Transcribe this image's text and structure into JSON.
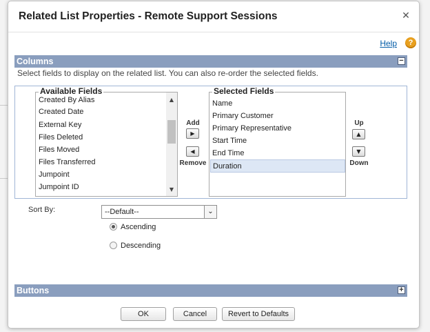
{
  "dialog": {
    "title": "Related List Properties - Remote Support Sessions",
    "close_icon": "close-icon",
    "help_label": "Help",
    "help_icon": "help-icon"
  },
  "columns_section": {
    "title": "Columns",
    "description": "Select fields to display on the related list. You can also re-order the selected fields.",
    "available_legend": "Available Fields",
    "available_fields": [
      "Created By Alias",
      "Created Date",
      "External Key",
      "Files Deleted",
      "Files Moved",
      "Files Transferred",
      "Jumpoint",
      "Jumpoint ID"
    ],
    "selected_legend": "Selected Fields",
    "selected_fields": [
      "Name",
      "Primary Customer",
      "Primary Representative",
      "Start Time",
      "End Time",
      "Duration"
    ],
    "selected_highlight": "Duration",
    "add_label": "Add",
    "remove_label": "Remove",
    "up_label": "Up",
    "down_label": "Down"
  },
  "sort": {
    "label": "Sort By:",
    "value": "--Default--",
    "ascending_label": "Ascending",
    "descending_label": "Descending",
    "selected_order": "Ascending"
  },
  "buttons_section": {
    "title": "Buttons"
  },
  "footer": {
    "ok": "OK",
    "cancel": "Cancel",
    "revert": "Revert to Defaults"
  },
  "colors": {
    "section_bar": "#8a9ebe",
    "link": "#015ba7",
    "help_icon": "#e8a020",
    "selected_row": "#dde7f5"
  }
}
